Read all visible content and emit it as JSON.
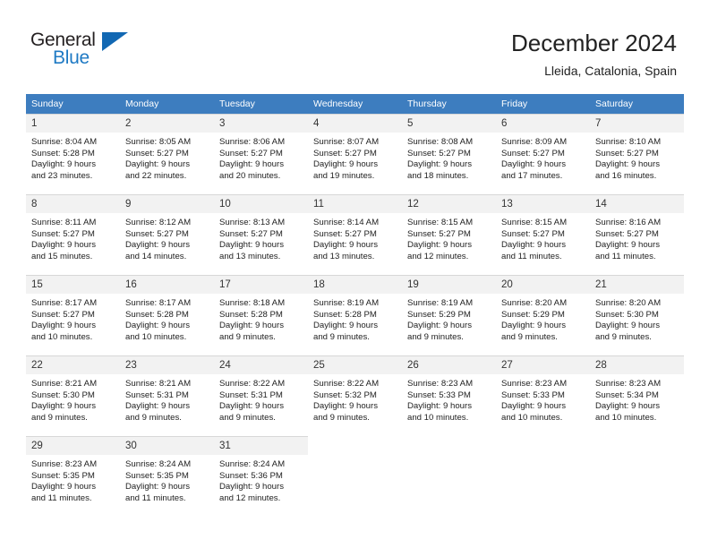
{
  "brand": {
    "name_part1": "General",
    "name_part2": "Blue",
    "triangle_icon": "triangle-icon",
    "colors": {
      "dark": "#231f20",
      "blue": "#1268b3"
    }
  },
  "header": {
    "title": "December 2024",
    "subtitle": "Lleida, Catalonia, Spain"
  },
  "calendar": {
    "header_color": "#3d7dbf",
    "weekdays": [
      "Sunday",
      "Monday",
      "Tuesday",
      "Wednesday",
      "Thursday",
      "Friday",
      "Saturday"
    ],
    "weeks": [
      [
        {
          "day": "1",
          "sunrise": "Sunrise: 8:04 AM",
          "sunset": "Sunset: 5:28 PM",
          "daylight1": "Daylight: 9 hours",
          "daylight2": "and 23 minutes."
        },
        {
          "day": "2",
          "sunrise": "Sunrise: 8:05 AM",
          "sunset": "Sunset: 5:27 PM",
          "daylight1": "Daylight: 9 hours",
          "daylight2": "and 22 minutes."
        },
        {
          "day": "3",
          "sunrise": "Sunrise: 8:06 AM",
          "sunset": "Sunset: 5:27 PM",
          "daylight1": "Daylight: 9 hours",
          "daylight2": "and 20 minutes."
        },
        {
          "day": "4",
          "sunrise": "Sunrise: 8:07 AM",
          "sunset": "Sunset: 5:27 PM",
          "daylight1": "Daylight: 9 hours",
          "daylight2": "and 19 minutes."
        },
        {
          "day": "5",
          "sunrise": "Sunrise: 8:08 AM",
          "sunset": "Sunset: 5:27 PM",
          "daylight1": "Daylight: 9 hours",
          "daylight2": "and 18 minutes."
        },
        {
          "day": "6",
          "sunrise": "Sunrise: 8:09 AM",
          "sunset": "Sunset: 5:27 PM",
          "daylight1": "Daylight: 9 hours",
          "daylight2": "and 17 minutes."
        },
        {
          "day": "7",
          "sunrise": "Sunrise: 8:10 AM",
          "sunset": "Sunset: 5:27 PM",
          "daylight1": "Daylight: 9 hours",
          "daylight2": "and 16 minutes."
        }
      ],
      [
        {
          "day": "8",
          "sunrise": "Sunrise: 8:11 AM",
          "sunset": "Sunset: 5:27 PM",
          "daylight1": "Daylight: 9 hours",
          "daylight2": "and 15 minutes."
        },
        {
          "day": "9",
          "sunrise": "Sunrise: 8:12 AM",
          "sunset": "Sunset: 5:27 PM",
          "daylight1": "Daylight: 9 hours",
          "daylight2": "and 14 minutes."
        },
        {
          "day": "10",
          "sunrise": "Sunrise: 8:13 AM",
          "sunset": "Sunset: 5:27 PM",
          "daylight1": "Daylight: 9 hours",
          "daylight2": "and 13 minutes."
        },
        {
          "day": "11",
          "sunrise": "Sunrise: 8:14 AM",
          "sunset": "Sunset: 5:27 PM",
          "daylight1": "Daylight: 9 hours",
          "daylight2": "and 13 minutes."
        },
        {
          "day": "12",
          "sunrise": "Sunrise: 8:15 AM",
          "sunset": "Sunset: 5:27 PM",
          "daylight1": "Daylight: 9 hours",
          "daylight2": "and 12 minutes."
        },
        {
          "day": "13",
          "sunrise": "Sunrise: 8:15 AM",
          "sunset": "Sunset: 5:27 PM",
          "daylight1": "Daylight: 9 hours",
          "daylight2": "and 11 minutes."
        },
        {
          "day": "14",
          "sunrise": "Sunrise: 8:16 AM",
          "sunset": "Sunset: 5:27 PM",
          "daylight1": "Daylight: 9 hours",
          "daylight2": "and 11 minutes."
        }
      ],
      [
        {
          "day": "15",
          "sunrise": "Sunrise: 8:17 AM",
          "sunset": "Sunset: 5:27 PM",
          "daylight1": "Daylight: 9 hours",
          "daylight2": "and 10 minutes."
        },
        {
          "day": "16",
          "sunrise": "Sunrise: 8:17 AM",
          "sunset": "Sunset: 5:28 PM",
          "daylight1": "Daylight: 9 hours",
          "daylight2": "and 10 minutes."
        },
        {
          "day": "17",
          "sunrise": "Sunrise: 8:18 AM",
          "sunset": "Sunset: 5:28 PM",
          "daylight1": "Daylight: 9 hours",
          "daylight2": "and 9 minutes."
        },
        {
          "day": "18",
          "sunrise": "Sunrise: 8:19 AM",
          "sunset": "Sunset: 5:28 PM",
          "daylight1": "Daylight: 9 hours",
          "daylight2": "and 9 minutes."
        },
        {
          "day": "19",
          "sunrise": "Sunrise: 8:19 AM",
          "sunset": "Sunset: 5:29 PM",
          "daylight1": "Daylight: 9 hours",
          "daylight2": "and 9 minutes."
        },
        {
          "day": "20",
          "sunrise": "Sunrise: 8:20 AM",
          "sunset": "Sunset: 5:29 PM",
          "daylight1": "Daylight: 9 hours",
          "daylight2": "and 9 minutes."
        },
        {
          "day": "21",
          "sunrise": "Sunrise: 8:20 AM",
          "sunset": "Sunset: 5:30 PM",
          "daylight1": "Daylight: 9 hours",
          "daylight2": "and 9 minutes."
        }
      ],
      [
        {
          "day": "22",
          "sunrise": "Sunrise: 8:21 AM",
          "sunset": "Sunset: 5:30 PM",
          "daylight1": "Daylight: 9 hours",
          "daylight2": "and 9 minutes."
        },
        {
          "day": "23",
          "sunrise": "Sunrise: 8:21 AM",
          "sunset": "Sunset: 5:31 PM",
          "daylight1": "Daylight: 9 hours",
          "daylight2": "and 9 minutes."
        },
        {
          "day": "24",
          "sunrise": "Sunrise: 8:22 AM",
          "sunset": "Sunset: 5:31 PM",
          "daylight1": "Daylight: 9 hours",
          "daylight2": "and 9 minutes."
        },
        {
          "day": "25",
          "sunrise": "Sunrise: 8:22 AM",
          "sunset": "Sunset: 5:32 PM",
          "daylight1": "Daylight: 9 hours",
          "daylight2": "and 9 minutes."
        },
        {
          "day": "26",
          "sunrise": "Sunrise: 8:23 AM",
          "sunset": "Sunset: 5:33 PM",
          "daylight1": "Daylight: 9 hours",
          "daylight2": "and 10 minutes."
        },
        {
          "day": "27",
          "sunrise": "Sunrise: 8:23 AM",
          "sunset": "Sunset: 5:33 PM",
          "daylight1": "Daylight: 9 hours",
          "daylight2": "and 10 minutes."
        },
        {
          "day": "28",
          "sunrise": "Sunrise: 8:23 AM",
          "sunset": "Sunset: 5:34 PM",
          "daylight1": "Daylight: 9 hours",
          "daylight2": "and 10 minutes."
        }
      ],
      [
        {
          "day": "29",
          "sunrise": "Sunrise: 8:23 AM",
          "sunset": "Sunset: 5:35 PM",
          "daylight1": "Daylight: 9 hours",
          "daylight2": "and 11 minutes."
        },
        {
          "day": "30",
          "sunrise": "Sunrise: 8:24 AM",
          "sunset": "Sunset: 5:35 PM",
          "daylight1": "Daylight: 9 hours",
          "daylight2": "and 11 minutes."
        },
        {
          "day": "31",
          "sunrise": "Sunrise: 8:24 AM",
          "sunset": "Sunset: 5:36 PM",
          "daylight1": "Daylight: 9 hours",
          "daylight2": "and 12 minutes."
        },
        {
          "day": "",
          "sunrise": "",
          "sunset": "",
          "daylight1": "",
          "daylight2": ""
        },
        {
          "day": "",
          "sunrise": "",
          "sunset": "",
          "daylight1": "",
          "daylight2": ""
        },
        {
          "day": "",
          "sunrise": "",
          "sunset": "",
          "daylight1": "",
          "daylight2": ""
        },
        {
          "day": "",
          "sunrise": "",
          "sunset": "",
          "daylight1": "",
          "daylight2": ""
        }
      ]
    ]
  }
}
